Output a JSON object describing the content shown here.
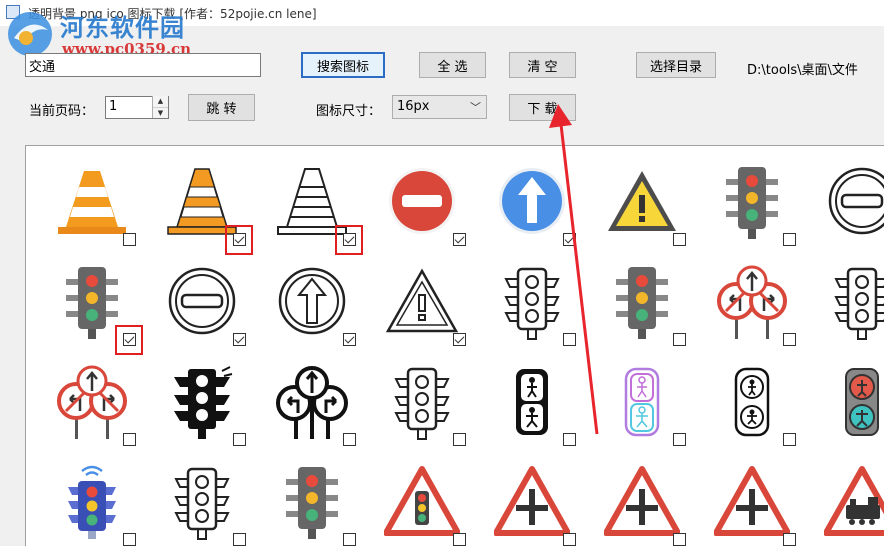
{
  "window": {
    "title": "透明背景 png ico 图标下载 [作者：52pojie.cn lene]"
  },
  "watermark": {
    "site_name": "河东软件园",
    "url": "www.pc0359.cn"
  },
  "toolbar": {
    "search_value": "交通",
    "search_button": "搜索图标",
    "select_all_button": "全 选",
    "clear_button": "清 空",
    "choose_dir_button": "选择目录",
    "directory_path": "D:\\tools\\桌面\\文件",
    "page_label": "当前页码：",
    "page_value": "1",
    "jump_button": "跳 转",
    "size_label": "图标尺寸：",
    "size_value": "16px",
    "download_button": "下 载"
  },
  "icons": [
    {
      "name": "traffic-cone-orange-icon",
      "checked": false,
      "highlighted": false
    },
    {
      "name": "traffic-cone-flat-icon",
      "checked": true,
      "highlighted": true
    },
    {
      "name": "traffic-cone-outline-icon",
      "checked": true,
      "highlighted": true
    },
    {
      "name": "no-entry-sign-icon",
      "checked": true,
      "highlighted": false
    },
    {
      "name": "ahead-only-sign-icon",
      "checked": true,
      "highlighted": false
    },
    {
      "name": "warning-triangle-icon",
      "checked": false,
      "highlighted": false
    },
    {
      "name": "traffic-light-color-icon",
      "checked": false,
      "highlighted": false
    },
    {
      "name": "no-entry-outline-icon",
      "checked": false,
      "highlighted": false
    },
    {
      "name": "traffic-light-color-icon",
      "checked": true,
      "highlighted": true
    },
    {
      "name": "no-entry-outline-icon",
      "checked": true,
      "highlighted": false
    },
    {
      "name": "ahead-only-outline-icon",
      "checked": true,
      "highlighted": false
    },
    {
      "name": "warning-triangle-outline-icon",
      "checked": true,
      "highlighted": false
    },
    {
      "name": "traffic-light-outline-icon",
      "checked": false,
      "highlighted": false
    },
    {
      "name": "traffic-light-color-icon",
      "checked": false,
      "highlighted": false
    },
    {
      "name": "no-turn-signs-icon",
      "checked": false,
      "highlighted": false
    },
    {
      "name": "traffic-light-outline-icon",
      "checked": false,
      "highlighted": false
    },
    {
      "name": "no-turn-signs-icon",
      "checked": false,
      "highlighted": false
    },
    {
      "name": "traffic-light-solid-icon",
      "checked": false,
      "highlighted": false
    },
    {
      "name": "turn-signs-solid-icon",
      "checked": false,
      "highlighted": false
    },
    {
      "name": "traffic-light-outline-icon",
      "checked": false,
      "highlighted": false
    },
    {
      "name": "pedestrian-signal-solid-icon",
      "checked": false,
      "highlighted": false
    },
    {
      "name": "pedestrian-signal-gradient-icon",
      "checked": false,
      "highlighted": false
    },
    {
      "name": "pedestrian-signal-outline-icon",
      "checked": false,
      "highlighted": false
    },
    {
      "name": "pedestrian-signal-color-icon",
      "checked": false,
      "highlighted": false
    },
    {
      "name": "smart-traffic-light-icon",
      "checked": false,
      "highlighted": false
    },
    {
      "name": "traffic-light-outline-icon",
      "checked": false,
      "highlighted": false
    },
    {
      "name": "traffic-light-color-icon",
      "checked": false,
      "highlighted": false
    },
    {
      "name": "traffic-light-warning-sign-icon",
      "checked": false,
      "highlighted": false
    },
    {
      "name": "crossroads-warning-sign-icon",
      "checked": false,
      "highlighted": false
    },
    {
      "name": "crossroads-warning-sign-icon",
      "checked": false,
      "highlighted": false
    },
    {
      "name": "crossroads-warning-sign-icon",
      "checked": false,
      "highlighted": false
    },
    {
      "name": "train-warning-sign-icon",
      "checked": false,
      "highlighted": false
    }
  ],
  "colors": {
    "highlight": "#e02020",
    "arrow": "#e8242c",
    "accent": "#2b6cc4"
  }
}
